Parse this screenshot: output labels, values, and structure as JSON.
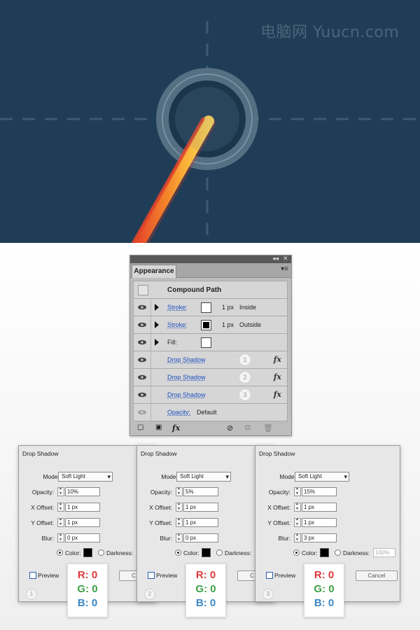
{
  "watermark": "电脑网 Yuucn.com",
  "panel": {
    "title": "Appearance",
    "header": "Compound Path",
    "rows": [
      {
        "label": "Stroke:",
        "value": "1 px",
        "extra": "Inside"
      },
      {
        "label": "Stroke:",
        "value": "1 px",
        "extra": "Outside"
      },
      {
        "label": "Fill:"
      },
      {
        "label": "Drop Shadow",
        "badge": "1"
      },
      {
        "label": "Drop Shadow",
        "badge": "2"
      },
      {
        "label": "Drop Shadow",
        "badge": "3"
      },
      {
        "label": "Opacity:",
        "value": "Default"
      }
    ],
    "fx": "fx"
  },
  "dialogs": [
    {
      "title": "Drop Shadow",
      "mode": "Soft Light",
      "opacity": "10%",
      "x_offset": "1 px",
      "y_offset": "1 px",
      "blur": "0 px",
      "badge": "1"
    },
    {
      "title": "Drop Shadow",
      "mode": "Soft Light",
      "opacity": "5%",
      "x_offset": "1 px",
      "y_offset": "1 px",
      "blur": "0 px",
      "badge": "2"
    },
    {
      "title": "Drop Shadow",
      "mode": "Soft Light",
      "opacity": "15%",
      "x_offset": "1 px",
      "y_offset": "1 px",
      "blur": "3 px",
      "badge": "3"
    }
  ],
  "labels": {
    "mode": "Mode:",
    "opacity": "Opacity:",
    "x_offset": "X Offset:",
    "y_offset": "Y Offset:",
    "blur": "Blur:",
    "color": "Color:",
    "darkness": "Darkness:",
    "preview": "Preview",
    "darkness_value": "100%",
    "cancel": "Cancel",
    "cancel_short": "Canc",
    "cancel_tiny": "C"
  },
  "rgb": {
    "r": "R: 0",
    "g": "G: 0",
    "b": "B: 0"
  },
  "colors": {
    "canvas_bg": "#1f3d56",
    "orange": "#f6a623",
    "red_stroke": "#e2452b"
  }
}
